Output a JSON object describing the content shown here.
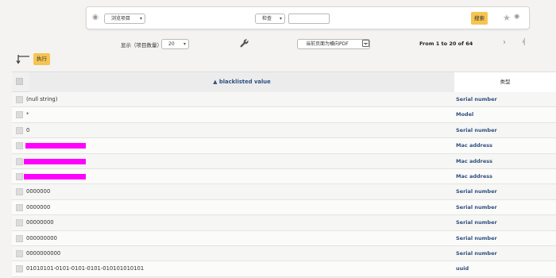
{
  "search_panel": {
    "browse_select": "浏览项目",
    "check_select": "检查",
    "search_input_value": "",
    "search_button": "搜索"
  },
  "toolbar": {
    "items_label": "显示（项目数量）",
    "items_count": "20",
    "pdf_select": "当前页面为横向PDF",
    "range": "From 1 to 20 of 64",
    "next": "›",
    "last": "›|"
  },
  "actions": {
    "execute_button": "执行"
  },
  "table": {
    "header_value": "▲ blacklisted value",
    "header_type": "类型",
    "rows": [
      {
        "value": "(null string)",
        "type": "Serial number"
      },
      {
        "value": "*",
        "type": "Model"
      },
      {
        "value": "0",
        "type": "Serial number"
      },
      {
        "value": "",
        "type": "Mac address",
        "redacted": true
      },
      {
        "value": "",
        "type": "Mac address",
        "redacted": true
      },
      {
        "value": "",
        "type": "Mac address",
        "redacted": true
      },
      {
        "value": "0000000",
        "type": "Serial number"
      },
      {
        "value": "0000000",
        "type": "Serial number"
      },
      {
        "value": "00000000",
        "type": "Serial number"
      },
      {
        "value": "000000000",
        "type": "Serial number"
      },
      {
        "value": "0000000000",
        "type": "Serial number"
      },
      {
        "value": "01010101-0101-0101-0101-010101010101",
        "type": "uuid"
      }
    ]
  },
  "colors": {
    "accent_button": "#f6c451",
    "link_blue": "#2f4f7f",
    "redaction": "#ff00ff"
  }
}
